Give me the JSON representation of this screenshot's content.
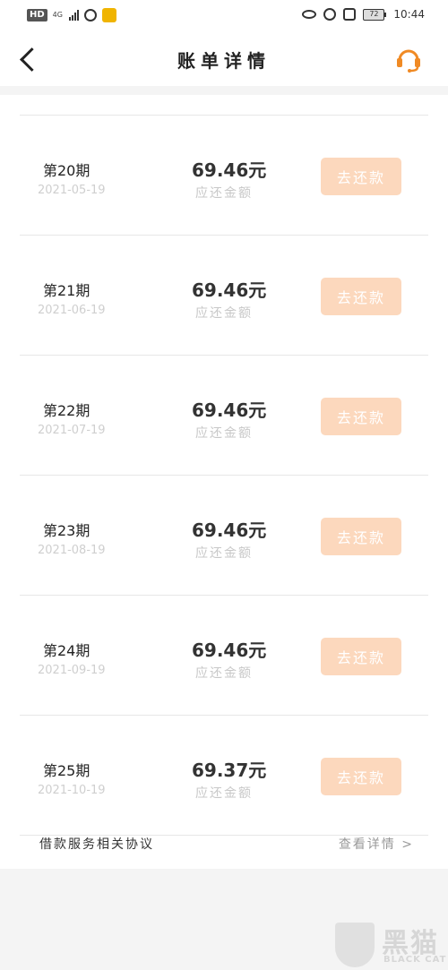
{
  "status_bar": {
    "hd": "HD",
    "network": "4G",
    "battery": "72",
    "time": "10:44"
  },
  "header": {
    "title": "账单详情"
  },
  "installments": [
    {
      "period": "第20期",
      "date": "2021-05-19",
      "amount": "69.46元",
      "amount_label": "应还金额",
      "button_label": "去还款"
    },
    {
      "period": "第21期",
      "date": "2021-06-19",
      "amount": "69.46元",
      "amount_label": "应还金额",
      "button_label": "去还款"
    },
    {
      "period": "第22期",
      "date": "2021-07-19",
      "amount": "69.46元",
      "amount_label": "应还金额",
      "button_label": "去还款"
    },
    {
      "period": "第23期",
      "date": "2021-08-19",
      "amount": "69.46元",
      "amount_label": "应还金额",
      "button_label": "去还款"
    },
    {
      "period": "第24期",
      "date": "2021-09-19",
      "amount": "69.46元",
      "amount_label": "应还金额",
      "button_label": "去还款"
    },
    {
      "period": "第25期",
      "date": "2021-10-19",
      "amount": "69.37元",
      "amount_label": "应还金额",
      "button_label": "去还款"
    }
  ],
  "footer": {
    "agreement_label": "借款服务相关协议",
    "details_link": "查看详情 >"
  },
  "watermark": {
    "brand": "黑猫",
    "sub": "BLACK CAT"
  },
  "colors": {
    "accent": "#f08a24",
    "button_disabled": "#fcd8bd"
  }
}
